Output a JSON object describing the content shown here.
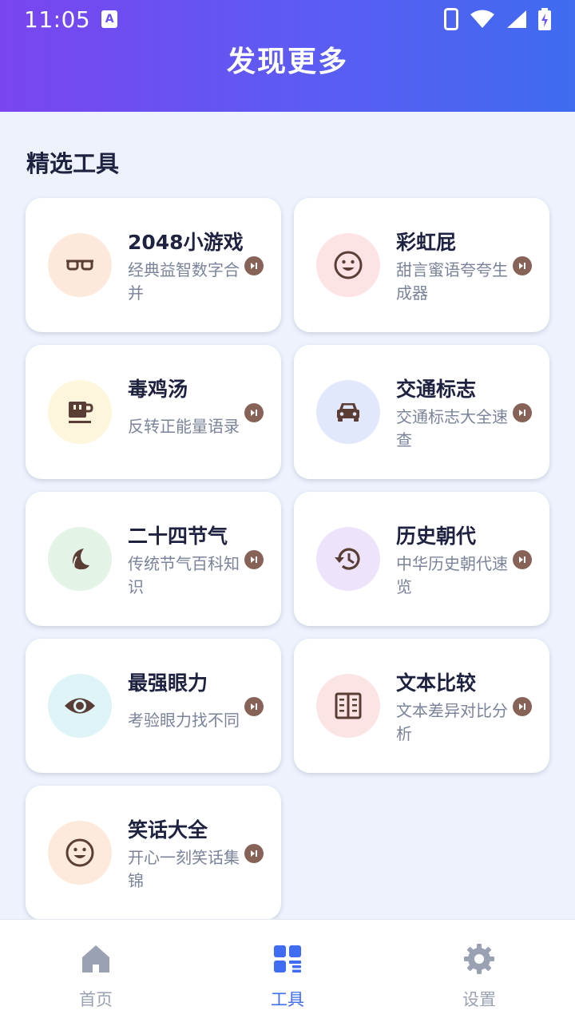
{
  "status_bar": {
    "time": "11:05",
    "notification_letter": "A"
  },
  "header": {
    "title": "发现更多"
  },
  "section": {
    "title": "精选工具"
  },
  "tools": [
    {
      "title": "2048小游戏",
      "desc": "经典益智数字合并",
      "icon": "glasses-icon",
      "bg": "#fde9dc"
    },
    {
      "title": "彩虹屁",
      "desc": "甜言蜜语夸夸生成器",
      "icon": "smile-icon",
      "bg": "#fde3e3"
    },
    {
      "title": "毒鸡汤",
      "desc": "反转正能量语录",
      "icon": "coffee-icon",
      "bg": "#fdf6dc"
    },
    {
      "title": "交通标志",
      "desc": "交通标志大全速查",
      "icon": "car-icon",
      "bg": "#e1e8fb"
    },
    {
      "title": "二十四节气",
      "desc": "传统节气百科知识",
      "icon": "leaf-icon",
      "bg": "#e3f3e5"
    },
    {
      "title": "历史朝代",
      "desc": "中华历史朝代速览",
      "icon": "history-icon",
      "bg": "#ede4fb"
    },
    {
      "title": "最强眼力",
      "desc": "考验眼力找不同",
      "icon": "eye-icon",
      "bg": "#def4f7"
    },
    {
      "title": "文本比较",
      "desc": "文本差异对比分析",
      "icon": "compare-icon",
      "bg": "#fde4e4"
    },
    {
      "title": "笑话大全",
      "desc": "开心一刻笑话集锦",
      "icon": "smile-icon",
      "bg": "#fdeadc"
    }
  ],
  "bottom_nav": [
    {
      "label": "首页",
      "icon": "home-icon",
      "active": false
    },
    {
      "label": "工具",
      "icon": "grid-icon",
      "active": true
    },
    {
      "label": "设置",
      "icon": "gear-icon",
      "active": false
    }
  ],
  "colors": {
    "accent": "#3f6cf0",
    "header_start": "#7a45ef",
    "icon_brown": "#5a3d35",
    "play_brown": "#876357"
  }
}
